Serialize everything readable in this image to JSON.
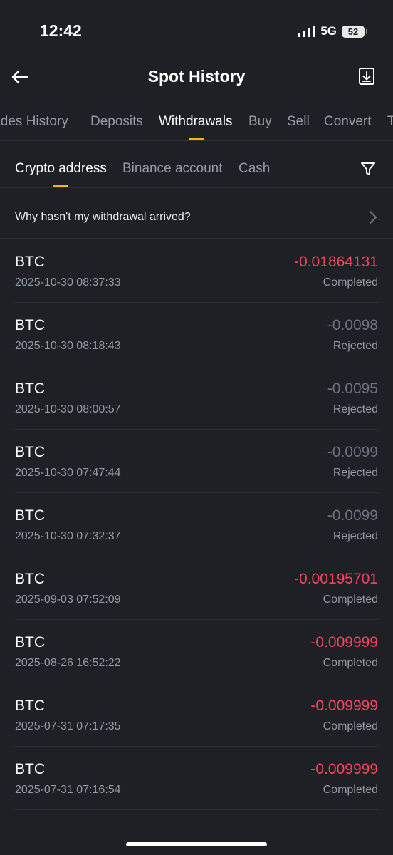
{
  "status_bar": {
    "time": "12:42",
    "network": "5G",
    "battery": "52"
  },
  "header": {
    "title": "Spot History"
  },
  "tabs": [
    {
      "label": "Trades History"
    },
    {
      "label": "Deposits"
    },
    {
      "label": "Withdrawals"
    },
    {
      "label": "Buy"
    },
    {
      "label": "Sell"
    },
    {
      "label": "Convert"
    },
    {
      "label": "T"
    }
  ],
  "subtabs": [
    {
      "label": "Crypto address"
    },
    {
      "label": "Binance account"
    },
    {
      "label": "Cash"
    }
  ],
  "help": {
    "text": "Why hasn't my withdrawal arrived?"
  },
  "colors": {
    "accent": "#f0b90b",
    "negative": "#f6465d",
    "muted": "#6b7280"
  },
  "withdrawals": [
    {
      "coin": "BTC",
      "time": "2025-10-30 08:37:33",
      "amount": "-0.01864131",
      "status": "Completed"
    },
    {
      "coin": "BTC",
      "time": "2025-10-30 08:18:43",
      "amount": "-0.0098",
      "status": "Rejected"
    },
    {
      "coin": "BTC",
      "time": "2025-10-30 08:00:57",
      "amount": "-0.0095",
      "status": "Rejected"
    },
    {
      "coin": "BTC",
      "time": "2025-10-30 07:47:44",
      "amount": "-0.0099",
      "status": "Rejected"
    },
    {
      "coin": "BTC",
      "time": "2025-10-30 07:32:37",
      "amount": "-0.0099",
      "status": "Rejected"
    },
    {
      "coin": "BTC",
      "time": "2025-09-03 07:52:09",
      "amount": "-0.00195701",
      "status": "Completed"
    },
    {
      "coin": "BTC",
      "time": "2025-08-26 16:52:22",
      "amount": "-0.009999",
      "status": "Completed"
    },
    {
      "coin": "BTC",
      "time": "2025-07-31 07:17:35",
      "amount": "-0.009999",
      "status": "Completed"
    },
    {
      "coin": "BTC",
      "time": "2025-07-31 07:16:54",
      "amount": "-0.009999",
      "status": "Completed"
    }
  ]
}
